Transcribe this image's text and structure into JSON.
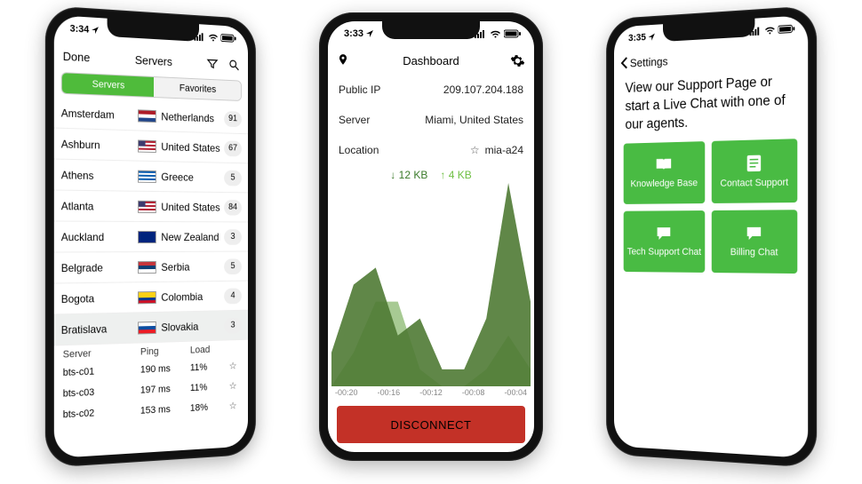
{
  "phones": {
    "servers": {
      "status_time": "3:34",
      "nav_done": "Done",
      "nav_title": "Servers",
      "tabs": {
        "servers": "Servers",
        "favorites": "Favorites"
      },
      "rows": [
        {
          "city": "Amsterdam",
          "flag": "nl",
          "country": "Netherlands",
          "count": "91"
        },
        {
          "city": "Ashburn",
          "flag": "us",
          "country": "United States",
          "count": "67"
        },
        {
          "city": "Athens",
          "flag": "gr",
          "country": "Greece",
          "count": "5"
        },
        {
          "city": "Atlanta",
          "flag": "us",
          "country": "United States",
          "count": "84"
        },
        {
          "city": "Auckland",
          "flag": "nz",
          "country": "New Zealand",
          "count": "3"
        },
        {
          "city": "Belgrade",
          "flag": "rs",
          "country": "Serbia",
          "count": "5"
        },
        {
          "city": "Bogota",
          "flag": "co",
          "country": "Colombia",
          "count": "4"
        },
        {
          "city": "Bratislava",
          "flag": "sk",
          "country": "Slovakia",
          "count": "3"
        }
      ],
      "sub_header": {
        "server": "Server",
        "ping": "Ping",
        "load": "Load"
      },
      "servers": [
        {
          "name": "bts-c01",
          "ping": "190 ms",
          "load": "11%"
        },
        {
          "name": "bts-c03",
          "ping": "197 ms",
          "load": "11%"
        },
        {
          "name": "bts-c02",
          "ping": "153 ms",
          "load": "18%"
        }
      ]
    },
    "dashboard": {
      "status_time": "3:33",
      "nav_title": "Dashboard",
      "info": {
        "ip_label": "Public IP",
        "ip_value": "209.107.204.188",
        "server_label": "Server",
        "server_value": "Miami, United States",
        "loc_label": "Location",
        "loc_value": "mia-a24"
      },
      "speed": {
        "down": "12 KB",
        "up": "4 KB"
      },
      "xticks": [
        "-00:20",
        "-00:16",
        "-00:12",
        "-00:08",
        "-00:04"
      ],
      "disconnect": "DISCONNECT"
    },
    "support": {
      "status_time": "3:35",
      "back_label": "Settings",
      "message": "View our Support Page or start a Live Chat with one of our agents.",
      "tiles": {
        "kb": "Knowledge Base",
        "contact": "Contact Support",
        "tech": "Tech Support Chat",
        "billing": "Billing Chat"
      }
    }
  },
  "chart_data": {
    "type": "area",
    "xlabel": "",
    "ylabel": "",
    "x": [
      "-00:20",
      "-00:18",
      "-00:16",
      "-00:14",
      "-00:12",
      "-00:10",
      "-00:08",
      "-00:06",
      "-00:04",
      "-00:02"
    ],
    "series": [
      {
        "name": "download",
        "color": "#4f7a34",
        "values": [
          2,
          6,
          7,
          3,
          4,
          1,
          1,
          4,
          12,
          5
        ]
      },
      {
        "name": "upload",
        "color": "#89b86f",
        "values": [
          0,
          2,
          5,
          5,
          1,
          0,
          0,
          1,
          3,
          1
        ]
      }
    ],
    "ylim": [
      0,
      12
    ]
  }
}
